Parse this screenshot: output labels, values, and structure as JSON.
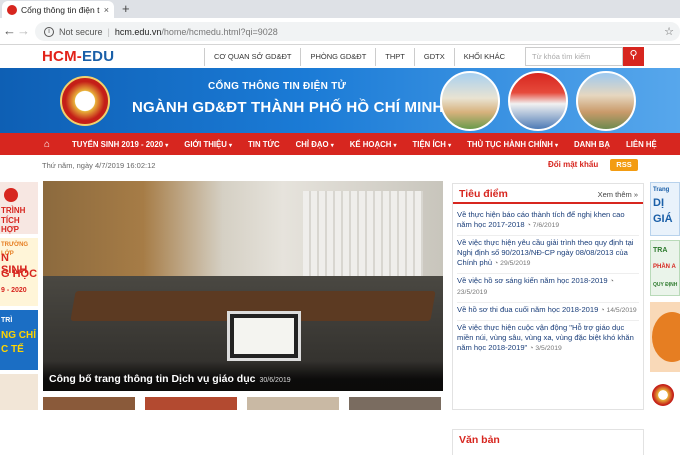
{
  "browser": {
    "tab_title": "Cổng thông tin điện tử Sở",
    "tab_close": "×",
    "new_tab": "+",
    "nav_back": "←",
    "nav_forward": "→",
    "nav_reload": "↻",
    "security": "Not secure",
    "url_host": "hcm.edu.vn",
    "url_path": "/home/hcmedu.html?qi=9028",
    "bookmark_star": "☆"
  },
  "header": {
    "logo_a": "HCM-",
    "logo_b": "EDU",
    "top_links": [
      "CƠ QUAN SỞ GD&ĐT",
      "PHÒNG GD&ĐT",
      "THPT",
      "GDTX",
      "KHỐI KHÁC"
    ],
    "search_placeholder": "Từ khóa tìm kiếm",
    "search_icon": "search-icon"
  },
  "banner": {
    "line1": "CỔNG THÔNG TIN ĐIỆN TỬ",
    "line2": "NGÀNH GD&ĐT THÀNH PHỐ HỒ CHÍ MINH"
  },
  "menu": {
    "home_icon": "home-icon",
    "items": [
      "TUYỂN SINH 2019 - 2020",
      "GIỚI THIỆU",
      "TIN TỨC",
      "CHỈ ĐẠO",
      "KẾ HOẠCH",
      "TIỆN ÍCH",
      "THỦ TỤC HÀNH CHÍNH",
      "DANH BẠ",
      "LIÊN HỆ"
    ],
    "dropdown_mark": "▾"
  },
  "datebar": {
    "date": "Thứ năm, ngày 4/7/2019 16:02:12",
    "changed_password": "Đổi mật khẩu",
    "rss": "RSS"
  },
  "hero": {
    "caption": "Công bố trang thông tin Dịch vụ giáo dục",
    "date": "30/6/2019"
  },
  "focus": {
    "title": "Tiêu điểm",
    "more": "Xem thêm »",
    "items": [
      {
        "text": "Về thực hiện báo cáo thành tích để nghị khen cao năm học 2017-2018",
        "date": "◔ 7/6/2019"
      },
      {
        "text": "Về việc thực hiện yêu cầu giải trình theo quy định tại Nghị định số 90/2013/NĐ-CP ngày 08/08/2013 của Chính phủ",
        "date": "◔ 29/5/2019"
      },
      {
        "text": "Về việc hồ sơ sáng kiến năm học 2018-2019",
        "date": "◔ 23/5/2019"
      },
      {
        "text": "Về hồ sơ thi đua cuối năm học 2018-2019",
        "date": "◔ 14/5/2019"
      },
      {
        "text": "Về việc thực hiện cuộc vận động \"Hỗ trợ giáo dục miền núi, vùng sâu, vùng xa, vùng đặc biệt khó khăn năm học 2018-2019\"",
        "date": "◔ 3/5/2019"
      }
    ]
  },
  "docs": {
    "title": "Văn bản"
  },
  "left_ads": [
    {
      "lines": [
        "TRÌNH",
        "TÍCH HỢP"
      ]
    },
    {
      "lines": [
        "TRƯỜNG LỚP",
        "N SINH",
        "G HỌC",
        "9 - 2020"
      ]
    },
    {
      "lines": [
        "TRÌ",
        "NG CHỈ",
        "C TẾ"
      ]
    },
    {
      "lines": []
    }
  ],
  "right_ads": [
    {
      "lines": [
        "Trang",
        "DỊ",
        "GIÁ"
      ]
    },
    {
      "lines": [
        "TRA",
        "PHẦN A",
        "QUY ĐỊNH"
      ]
    },
    {
      "lines": []
    },
    {
      "lines": []
    }
  ]
}
